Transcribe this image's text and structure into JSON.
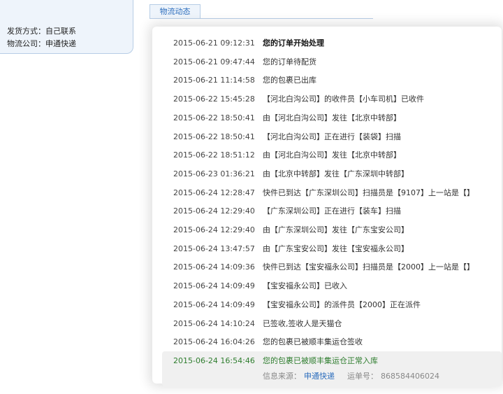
{
  "info": {
    "delivery_label": "发货方式：",
    "delivery_value": "自己联系",
    "company_label": "物流公司：",
    "company_value": "申通快递"
  },
  "tab": {
    "label": "物流动态"
  },
  "tracking": [
    {
      "time": "2015-06-21 09:12:31",
      "msg": "您的订单开始处理"
    },
    {
      "time": "2015-06-21 09:47:44",
      "msg": "您的订单待配货"
    },
    {
      "time": "2015-06-21 11:14:58",
      "msg": "您的包裹已出库"
    },
    {
      "time": "2015-06-22 15:45:28",
      "msg": "【河北白沟公司】的收件员【小车司机】已收件"
    },
    {
      "time": "2015-06-22 18:50:41",
      "msg": "由【河北白沟公司】发往【北京中转部】"
    },
    {
      "time": "2015-06-22 18:50:41",
      "msg": "【河北白沟公司】正在进行【装袋】扫描"
    },
    {
      "time": "2015-06-22 18:51:12",
      "msg": "由【河北白沟公司】发往【北京中转部】"
    },
    {
      "time": "2015-06-23 01:36:21",
      "msg": "由【北京中转部】发往【广东深圳中转部】"
    },
    {
      "time": "2015-06-24 12:28:47",
      "msg": "快件已到达【广东深圳公司】扫描员是【9107】上一站是【】"
    },
    {
      "time": "2015-06-24 12:29:40",
      "msg": "【广东深圳公司】正在进行【装车】扫描"
    },
    {
      "time": "2015-06-24 12:29:40",
      "msg": "由【广东深圳公司】发往【广东宝安公司】"
    },
    {
      "time": "2015-06-24 13:47:57",
      "msg": "由【广东宝安公司】发往【宝安福永公司】"
    },
    {
      "time": "2015-06-24 14:09:36",
      "msg": "快件已到达【宝安福永公司】扫描员是【2000】上一站是【】"
    },
    {
      "time": "2015-06-24 14:09:49",
      "msg": "【宝安福永公司】已收入"
    },
    {
      "time": "2015-06-24 14:09:49",
      "msg": "【宝安福永公司】的派件员【2000】正在派件"
    },
    {
      "time": "2015-06-24 14:10:24",
      "msg": "已签收,签收人是天猫仓"
    },
    {
      "time": "2015-06-24 16:04:26",
      "msg": "您的包裹已被顺丰集运仓签收"
    },
    {
      "time": "2015-06-24 16:54:46",
      "msg": "您的包裹已被顺丰集运仓正常入库"
    }
  ],
  "source": {
    "label": "信息来源：",
    "carrier": "申通快递",
    "waybill_label": "运单号：",
    "waybill_no": "868584406024"
  }
}
